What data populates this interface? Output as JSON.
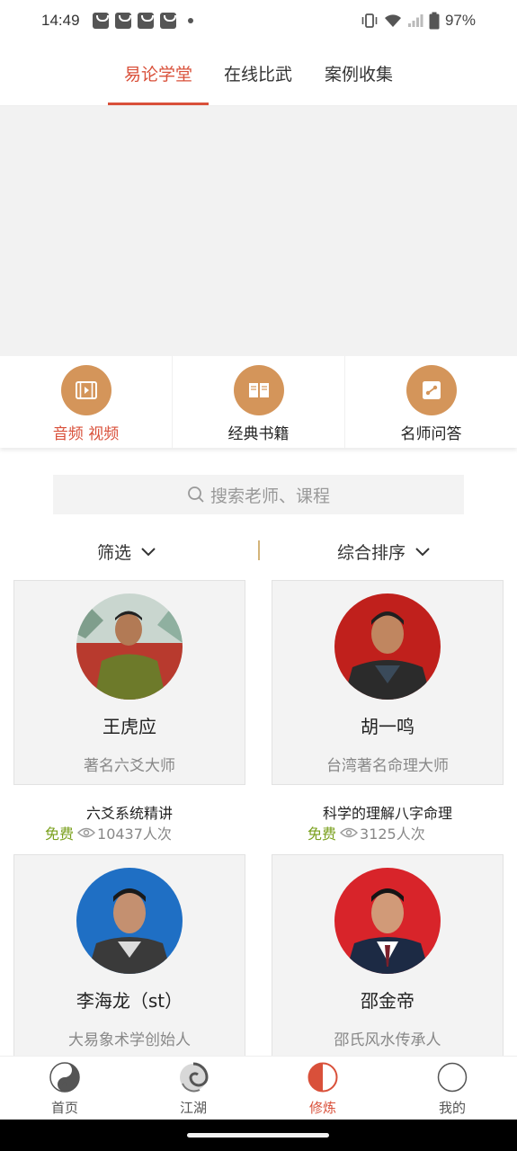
{
  "status_bar": {
    "time": "14:49",
    "battery": "97%"
  },
  "top_tabs": [
    {
      "label": "易论学堂",
      "active": true
    },
    {
      "label": "在线比武",
      "active": false
    },
    {
      "label": "案例收集",
      "active": false
    }
  ],
  "categories": [
    {
      "label": "音频 视频",
      "icon": "video-icon",
      "active": true
    },
    {
      "label": "经典书籍",
      "icon": "book-icon",
      "active": false
    },
    {
      "label": "名师问答",
      "icon": "qa-icon",
      "active": false
    }
  ],
  "search": {
    "placeholder": "搜索老师、课程"
  },
  "filters": {
    "filter_label": "筛选",
    "sort_label": "综合排序"
  },
  "teachers": [
    {
      "name": "王虎应",
      "title": "著名六爻大师",
      "course": "六爻系统精讲",
      "price": "免费",
      "views": "10437人次"
    },
    {
      "name": "胡一鸣",
      "title": "台湾著名命理大师",
      "course": "科学的理解八字命理",
      "price": "免费",
      "views": "3125人次"
    },
    {
      "name": "李海龙（st）",
      "title": "大易象术学创始人"
    },
    {
      "name": "邵金帝",
      "title": "邵氏风水传承人"
    }
  ],
  "bottom_nav": [
    {
      "label": "首页",
      "icon": "yin-yang-icon",
      "active": false
    },
    {
      "label": "江湖",
      "icon": "swirl-icon",
      "active": false
    },
    {
      "label": "修炼",
      "icon": "half-circle-icon",
      "active": true
    },
    {
      "label": "我的",
      "icon": "profile-circle-icon",
      "active": false
    }
  ],
  "colors": {
    "accent": "#d9503a",
    "category_icon_bg": "#d4955a",
    "free": "#7aa01d"
  }
}
